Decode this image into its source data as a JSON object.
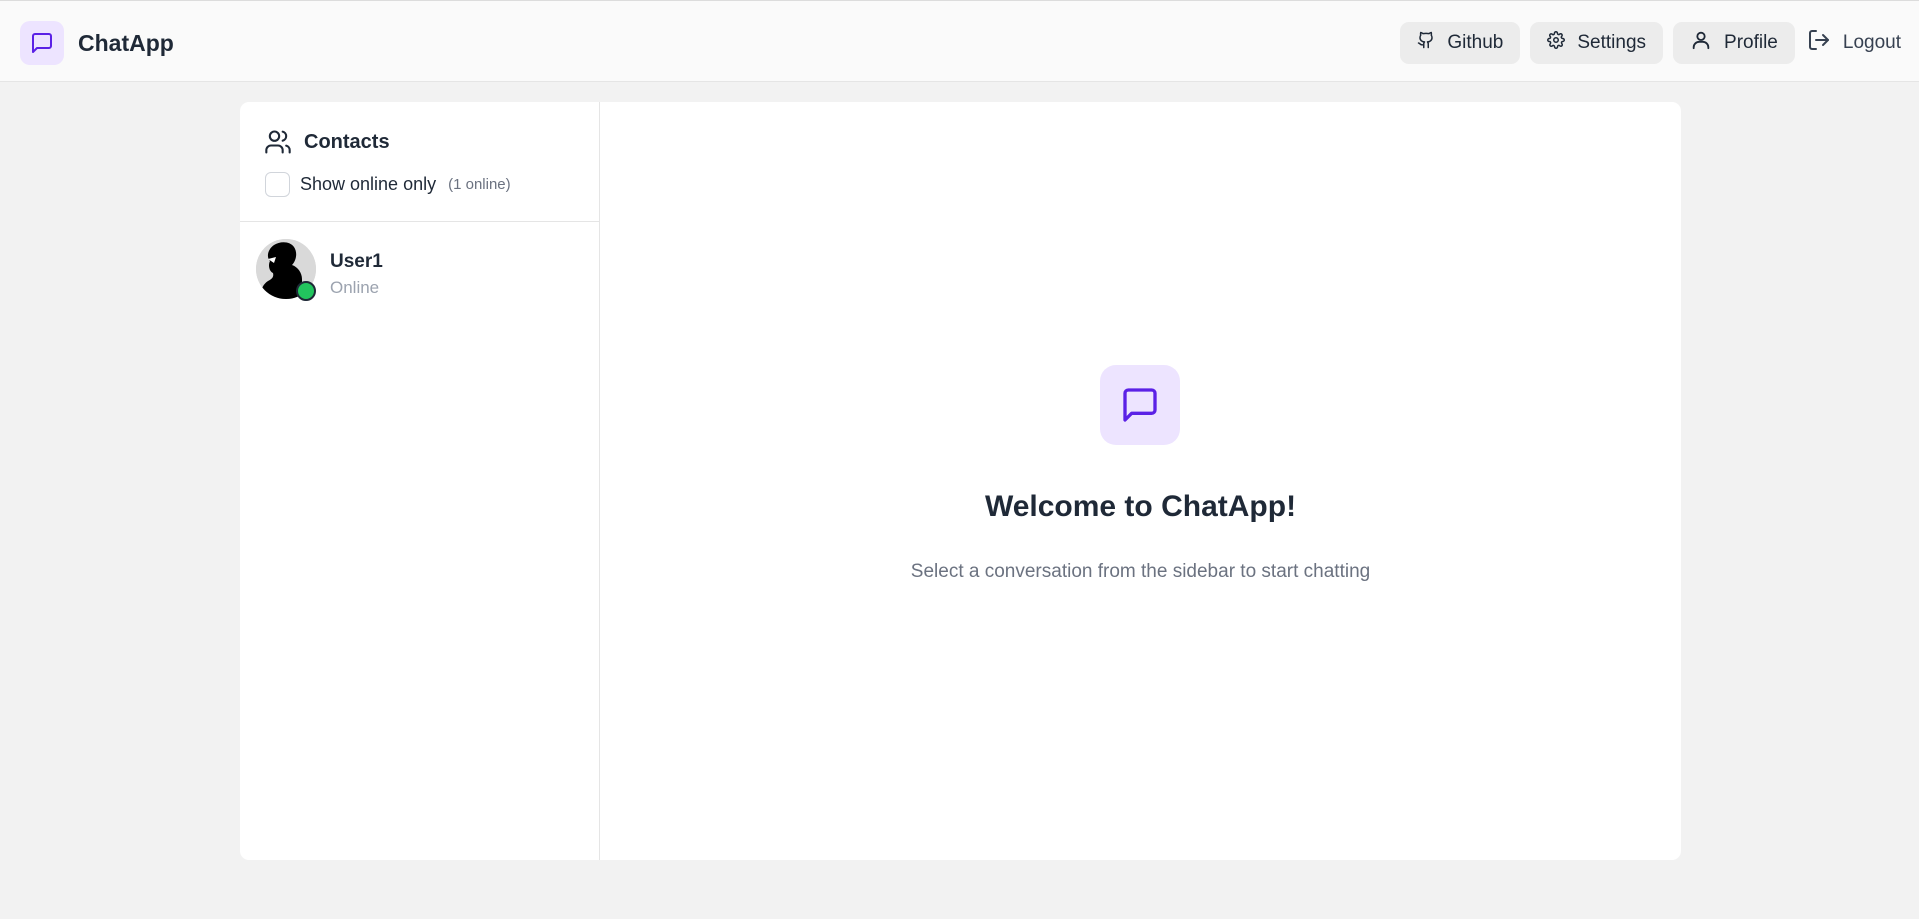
{
  "app": {
    "name": "ChatApp"
  },
  "nav": {
    "github": "Github",
    "settings": "Settings",
    "profile": "Profile",
    "logout": "Logout"
  },
  "sidebar": {
    "title": "Contacts",
    "filter_label": "Show online only",
    "online_count": "(1 online)",
    "contacts": [
      {
        "name": "User1",
        "status": "Online"
      }
    ]
  },
  "welcome": {
    "title": "Welcome to ChatApp!",
    "subtitle": "Select a conversation from the sidebar to start chatting"
  },
  "colors": {
    "accent": "#5b21e6",
    "accent_bg": "#ede4ff",
    "online": "#22c55e",
    "page_bg": "#f2f2f2"
  },
  "icons": [
    "message-square-icon",
    "github-icon",
    "gear-icon",
    "user-icon",
    "logout-icon",
    "users-icon"
  ]
}
